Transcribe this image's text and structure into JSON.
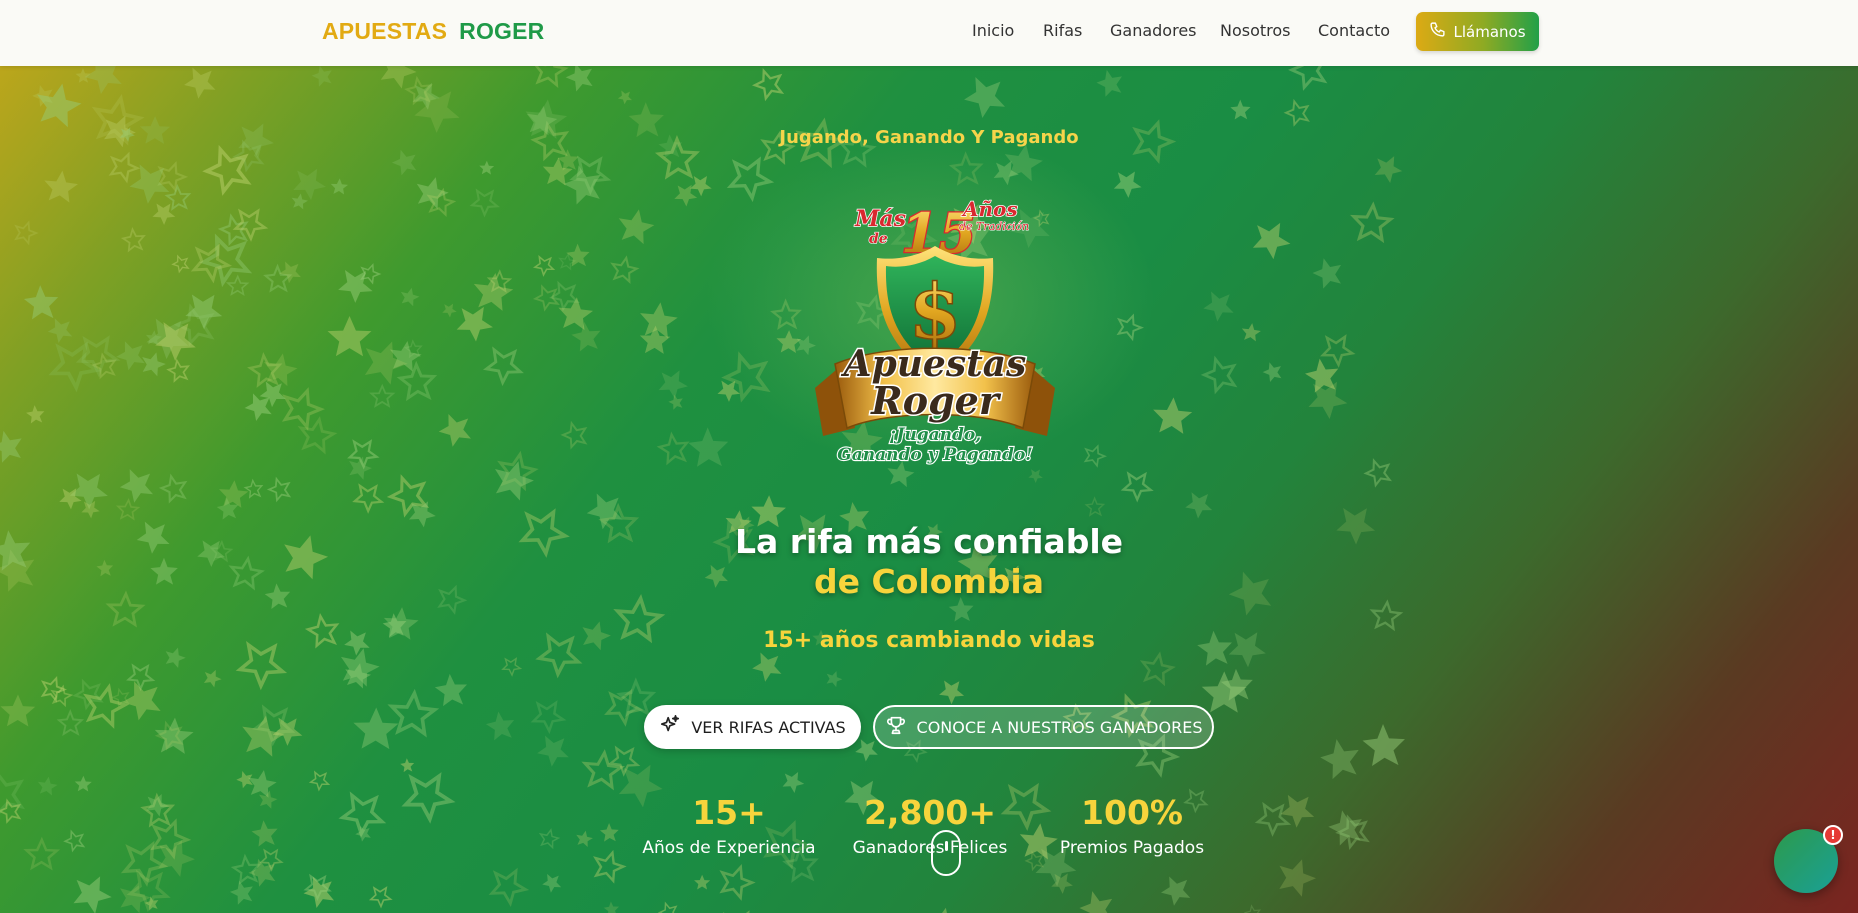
{
  "nav": {
    "brand_part1": "APUESTAS",
    "brand_part2": "ROGER",
    "links": [
      "Inicio",
      "Rifas",
      "Ganadores",
      "Nosotros",
      "Contacto"
    ],
    "call_label": "Llámanos"
  },
  "hero": {
    "tagline": "Jugando, Ganando Y Pagando",
    "logo": {
      "top_text_1": "Más",
      "top_text_2": "de",
      "top_number": "15",
      "top_text_3": "Años",
      "top_text_4": "de Tradición",
      "name_1": "Apuestas",
      "name_2": "Roger",
      "slogan_1": "¡Jugando,",
      "slogan_2": "Ganando y Pagando!"
    },
    "headline_1": "La rifa más confiable",
    "headline_2": "de Colombia",
    "subheadline": "15+ años cambiando vidas",
    "primary_button": "VER RIFAS ACTIVAS",
    "secondary_button": "CONOCE A NUESTROS GANADORES",
    "stats": [
      {
        "value": "15+",
        "label": "Años de Experiencia"
      },
      {
        "value": "2,800+",
        "label": "Ganadores Felices"
      },
      {
        "value": "100%",
        "label": "Premios Pagados"
      }
    ]
  },
  "chat": {
    "badge": "!"
  },
  "colors": {
    "gold": "#e2aa13",
    "green": "#1f9a48",
    "yellow_text": "#f7d43c",
    "badge_red": "#e53935"
  },
  "icons": [
    "phone-icon",
    "sparkles-icon",
    "trophy-icon",
    "scroll-mouse-icon",
    "chat-icon"
  ]
}
